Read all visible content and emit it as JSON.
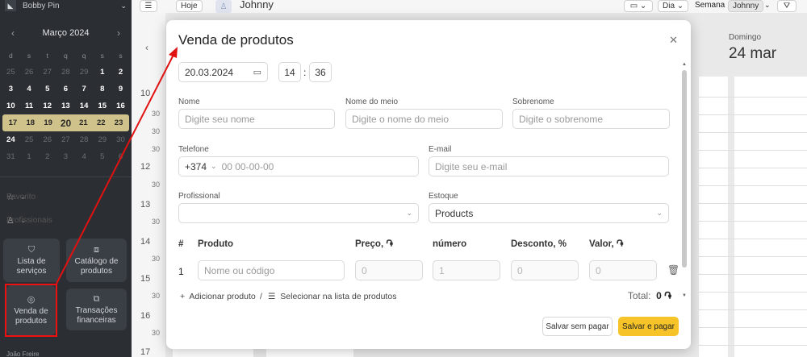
{
  "sidebar": {
    "user_name": "Bobby Pin",
    "calendar": {
      "month_label": "Março 2024",
      "weekdays": [
        "d",
        "s",
        "t",
        "q",
        "q",
        "s",
        "s"
      ],
      "weeks": [
        [
          "25",
          "26",
          "27",
          "28",
          "29",
          "1",
          "2"
        ],
        [
          "3",
          "4",
          "5",
          "6",
          "7",
          "8",
          "9"
        ],
        [
          "10",
          "11",
          "12",
          "13",
          "14",
          "15",
          "16"
        ],
        [
          "17",
          "18",
          "19",
          "20",
          "21",
          "22",
          "23"
        ],
        [
          "24",
          "25",
          "26",
          "27",
          "28",
          "29",
          "30"
        ],
        [
          "31",
          "1",
          "2",
          "3",
          "4",
          "5",
          "6"
        ]
      ]
    },
    "sections": {
      "favorites": "Favorito",
      "professionals": "Profissionais"
    },
    "tiles": {
      "services": "Lista de serviços",
      "catalog": "Catálogo de produtos",
      "product_sale": "Venda de produtos",
      "transactions": "Transações financeiras"
    },
    "bottom_user": "João Freire"
  },
  "topbar": {
    "today": "Hoje",
    "professional": "Johnny",
    "view_day": "Dia",
    "view_week": "Semana",
    "selected": "Johnny"
  },
  "calendar_view": {
    "day_name": "Domingo",
    "day_date": "24 mar",
    "times": [
      "10",
      "11",
      "12",
      "13",
      "14",
      "15",
      "16",
      "17"
    ],
    "half": "30"
  },
  "modal": {
    "title": "Venda de produtos",
    "date": "20.03.2024",
    "hour": "14",
    "minute": "36",
    "time_sep": ":",
    "fields": {
      "name_label": "Nome",
      "name_ph": "Digite seu nome",
      "middle_label": "Nome do meio",
      "middle_ph": "Digite o nome do meio",
      "surname_label": "Sobrenome",
      "surname_ph": "Digite o sobrenome",
      "phone_label": "Telefone",
      "phone_code": "+374",
      "phone_ph": "00 00-00-00",
      "email_label": "E-mail",
      "email_ph": "Digite seu e-mail",
      "professional_label": "Profissional",
      "professional_value": "",
      "stock_label": "Estoque",
      "stock_value": "Products"
    },
    "table": {
      "headers": [
        "#",
        "Produto",
        "Preço, ֏",
        "número",
        "Desconto, %",
        "Valor, ֏"
      ],
      "row": {
        "index": "1",
        "product_ph": "Nome ou código",
        "price": "0",
        "qty": "1",
        "discount": "0",
        "value": "0"
      }
    },
    "add_product": "Adicionar produto",
    "link_sep": "/",
    "select_list": "Selecionar na lista de produtos",
    "total_label": "Total:",
    "total_value": "0 ֏",
    "btn_save_unpaid": "Salvar sem pagar",
    "btn_save_pay": "Salvar e pagar"
  },
  "colors": {
    "sidebar_bg": "#2b2f33",
    "week_highlight": "#cfc28a",
    "primary_button": "#f6c428",
    "annotation": "#e11111"
  }
}
